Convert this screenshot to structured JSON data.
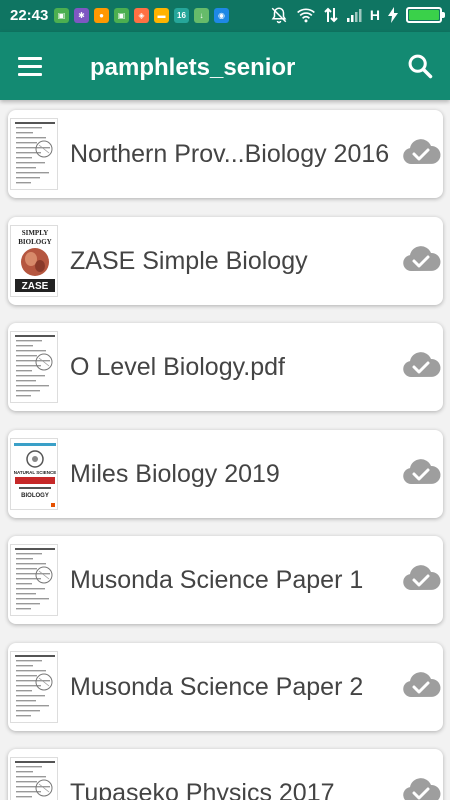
{
  "status_bar": {
    "time": "22:43",
    "network_type": "H",
    "notification_icons": [
      {
        "name": "android-app-icon",
        "color": "#4caf50",
        "glyph": "▣"
      },
      {
        "name": "grid-app-icon",
        "color": "#7e57c2",
        "glyph": "✱"
      },
      {
        "name": "media-app-icon",
        "color": "#ff9800",
        "glyph": "●"
      },
      {
        "name": "android-app-icon",
        "color": "#4caf50",
        "glyph": "▣"
      },
      {
        "name": "shop-app-icon",
        "color": "#ff7043",
        "glyph": "◈"
      },
      {
        "name": "folder-app-icon",
        "color": "#ffb300",
        "glyph": "▬"
      },
      {
        "name": "calendar-app-icon",
        "color": "#26a69a",
        "glyph": "16"
      },
      {
        "name": "download-app-icon",
        "color": "#66bb6a",
        "glyph": "↓"
      },
      {
        "name": "cube-app-icon",
        "color": "#1e88e5",
        "glyph": "◉"
      }
    ],
    "battery_color": "#3ad14a"
  },
  "app_bar": {
    "title": "pamphlets_senior",
    "background": "#138a72"
  },
  "files": [
    {
      "title": "Northern Prov...Biology 2016",
      "thumb": "doc"
    },
    {
      "title": "ZASE Simple Biology",
      "thumb": "zase"
    },
    {
      "title": "O Level Biology.pdf",
      "thumb": "doc"
    },
    {
      "title": "Miles Biology 2019",
      "thumb": "natural"
    },
    {
      "title": "Musonda Science Paper 1",
      "thumb": "doc"
    },
    {
      "title": "Musonda Science Paper 2",
      "thumb": "doc"
    },
    {
      "title": "Tupaseko Physics 2017",
      "thumb": "doc"
    }
  ],
  "thumb_text": {
    "zase_top": "SIMPLY",
    "zase_mid": "BIOLOGY",
    "zase_bottom": "ZASE",
    "miles_top": "NATURAL SCIENCE",
    "miles_bottom": "BIOLOGY"
  }
}
